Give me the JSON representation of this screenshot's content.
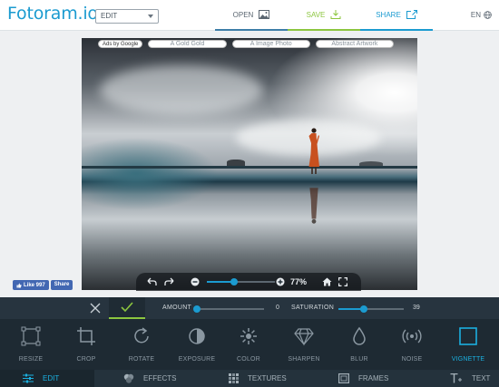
{
  "header": {
    "logo": "Fotoram.io",
    "mode": "EDIT",
    "open_label": "OPEN",
    "save_label": "SAVE",
    "share_label": "SHARE",
    "language": "EN"
  },
  "ads": {
    "tag": "Ads by Google",
    "links": [
      "A Gold Gold",
      "A Image Photo",
      "Abstract Artwork"
    ]
  },
  "zoom": {
    "percent_label": "77%",
    "level": 0.4
  },
  "social": {
    "like_label": "Like 997",
    "share_label": "Share"
  },
  "adjust": {
    "amount_label": "AMOUNT",
    "amount_value": "0",
    "amount_level": 0.02,
    "saturation_label": "SATURATION",
    "saturation_value": "39",
    "saturation_level": 0.39
  },
  "tools": [
    {
      "label": "RESIZE",
      "icon": "resize-icon"
    },
    {
      "label": "CROP",
      "icon": "crop-icon"
    },
    {
      "label": "ROTATE",
      "icon": "rotate-icon"
    },
    {
      "label": "EXPOSURE",
      "icon": "exposure-icon"
    },
    {
      "label": "COLOR",
      "icon": "color-icon"
    },
    {
      "label": "SHARPEN",
      "icon": "sharpen-icon"
    },
    {
      "label": "BLUR",
      "icon": "blur-icon"
    },
    {
      "label": "NOISE",
      "icon": "noise-icon"
    },
    {
      "label": "VIGNETTE",
      "icon": "vignette-icon"
    }
  ],
  "tabs": [
    {
      "label": "EDIT",
      "icon": "sliders-icon"
    },
    {
      "label": "EFFECTS",
      "icon": "effects-icon"
    },
    {
      "label": "TEXTURES",
      "icon": "textures-icon"
    },
    {
      "label": "FRAMES",
      "icon": "frames-icon"
    },
    {
      "label": "TEXT",
      "icon": "text-icon"
    }
  ],
  "colors": {
    "accent": "#1b9bd0",
    "save_green": "#8cc63f",
    "toolbar_bg": "#1e2a33"
  }
}
